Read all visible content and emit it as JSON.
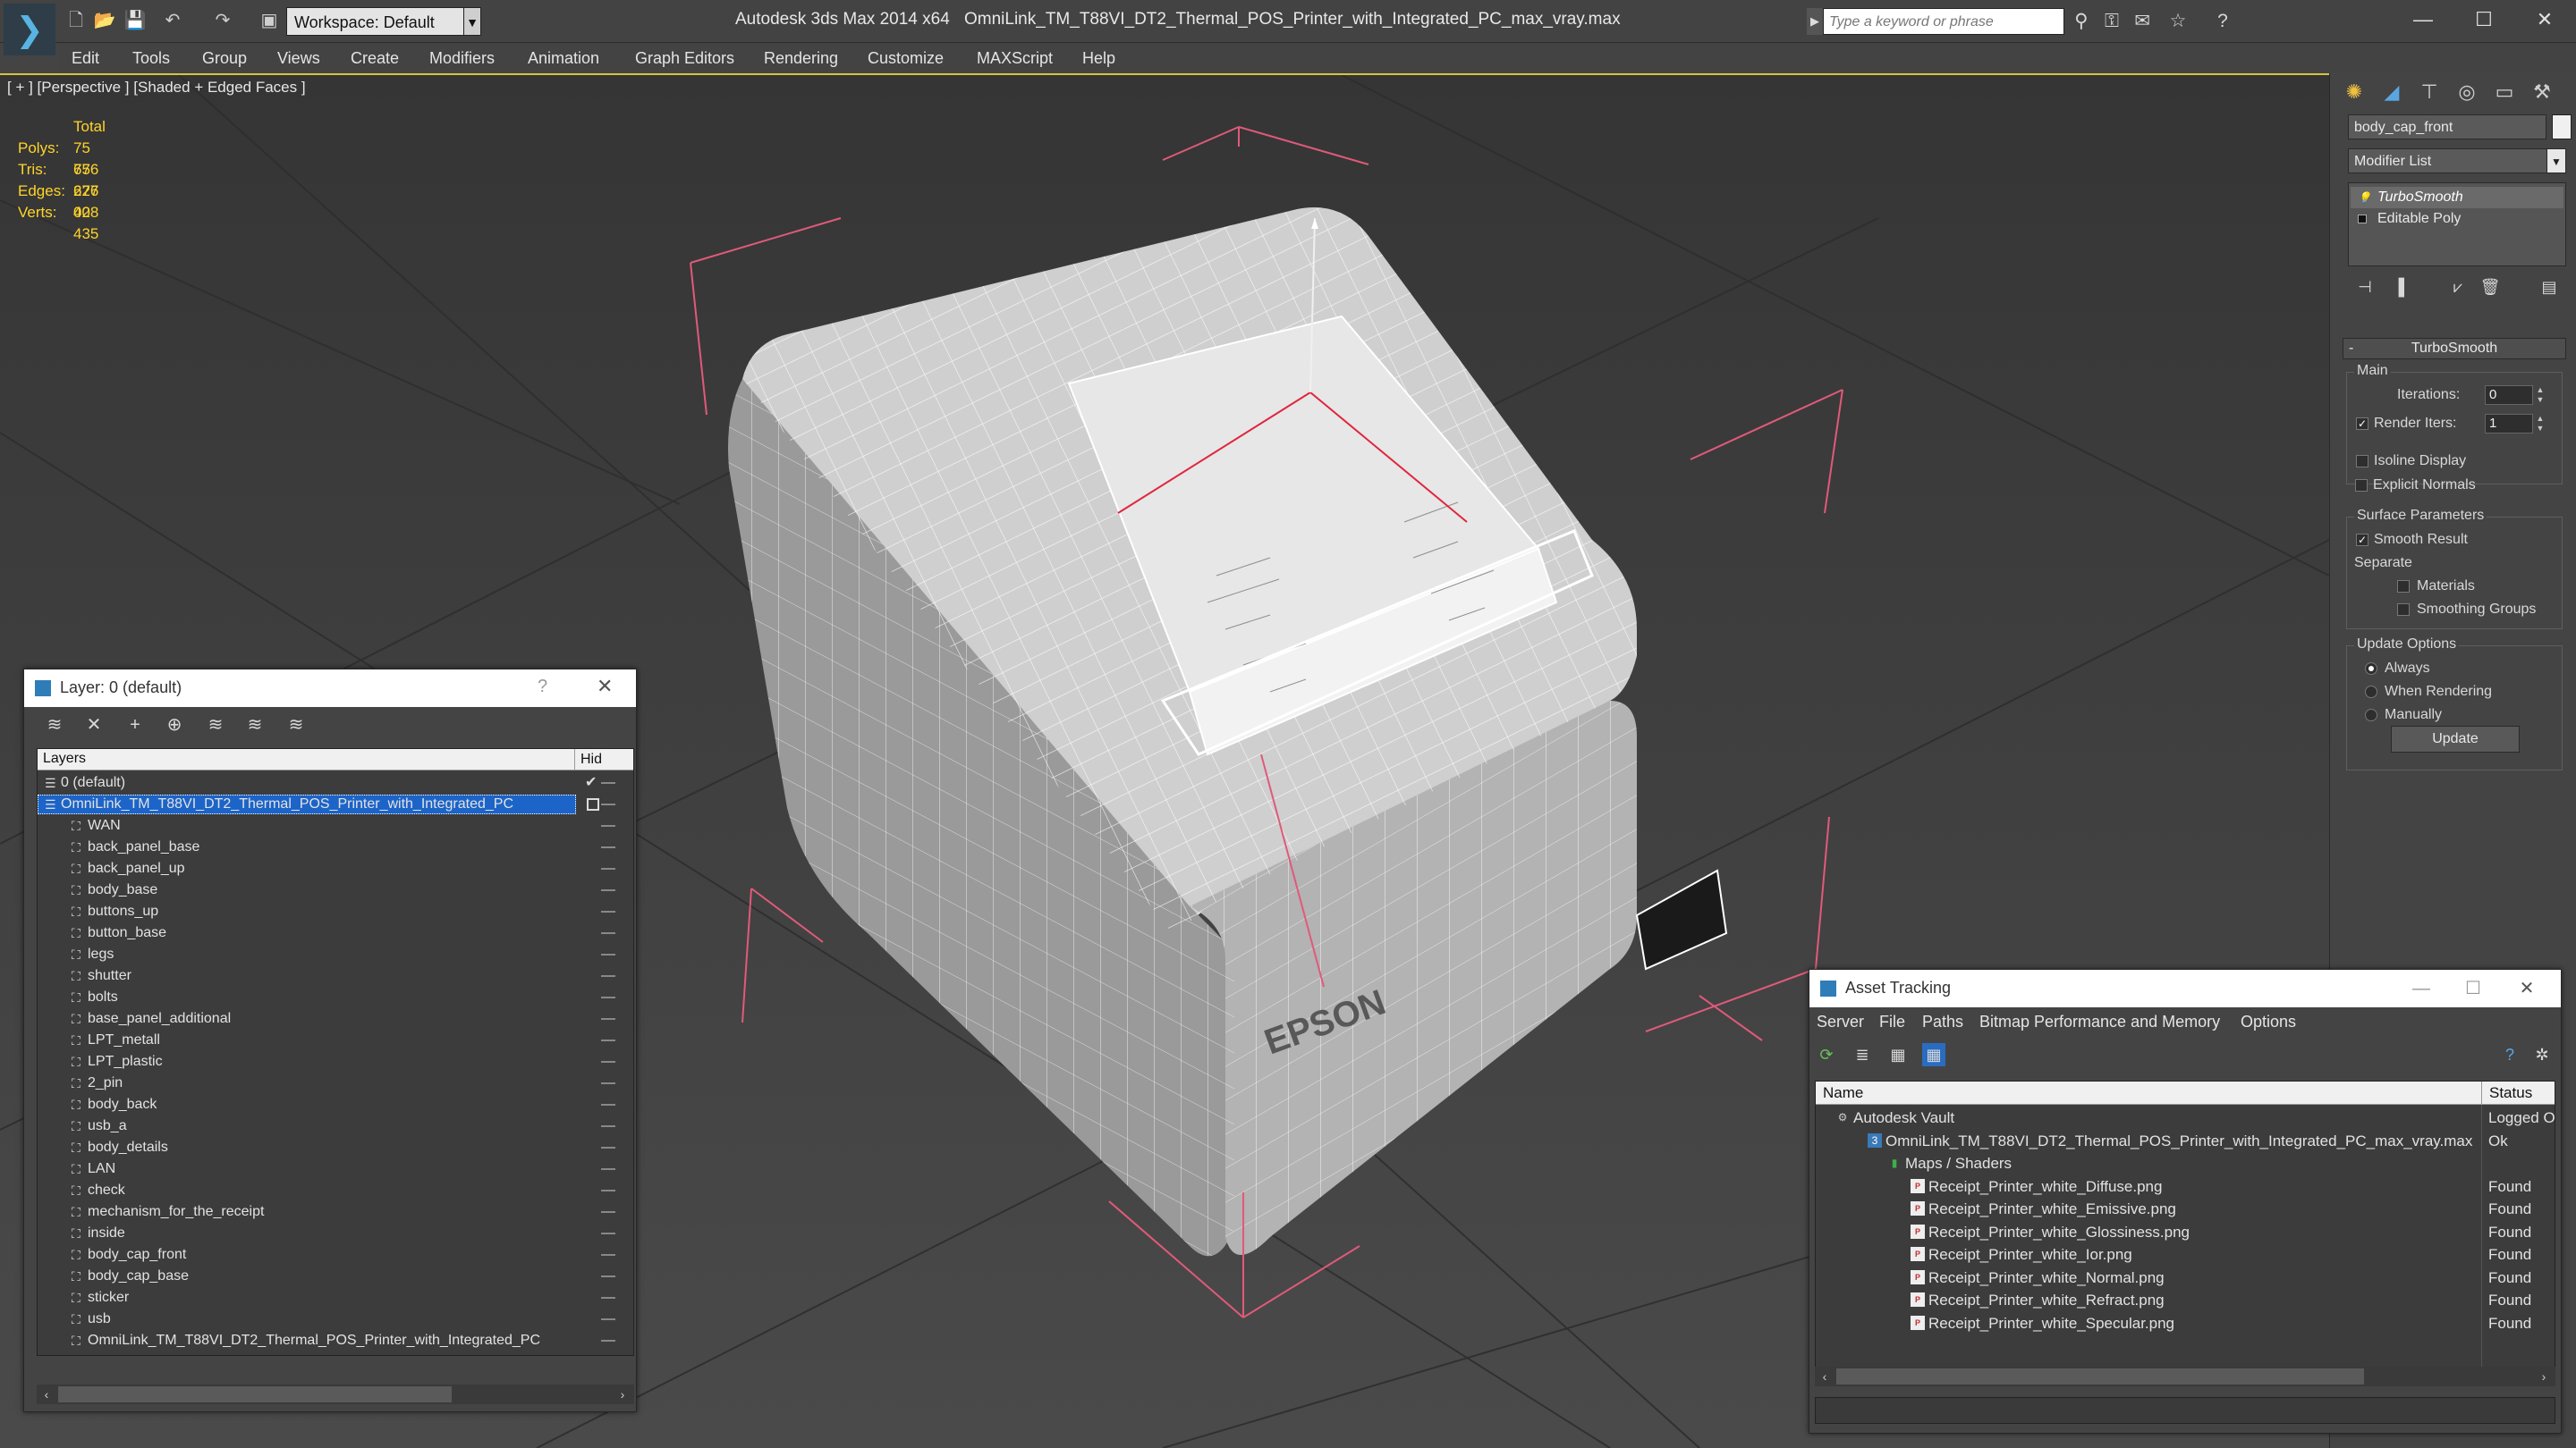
{
  "titlebar": {
    "workspace": "Workspace: Default",
    "app_name": "Autodesk 3ds Max  2014 x64",
    "document": "OmniLink_TM_T88VI_DT2_Thermal_POS_Printer_with_Integrated_PC_max_vray.max",
    "search_placeholder": "Type a keyword or phrase"
  },
  "menu": [
    "Edit",
    "Tools",
    "Group",
    "Views",
    "Create",
    "Modifiers",
    "Animation",
    "Graph Editors",
    "Rendering",
    "Customize",
    "MAXScript",
    "Help"
  ],
  "viewport": {
    "label": "[ + ] [Perspective ] [Shaded + Edged Faces ]",
    "stats": {
      "header": "Total",
      "rows": [
        {
          "k": "Polys:",
          "v": "75 676"
        },
        {
          "k": "Tris:",
          "v": "75 676"
        },
        {
          "k": "Edges:",
          "v": "227 028"
        },
        {
          "k": "Verts:",
          "v": "40 435"
        }
      ]
    },
    "brand_text": "EPSON"
  },
  "command_panel": {
    "object_name": "body_cap_front",
    "modifier_list": "Modifier List",
    "stack": [
      "TurboSmooth",
      "Editable Poly"
    ],
    "rollout_title": "TurboSmooth",
    "main_label": "Main",
    "iterations_label": "Iterations:",
    "iterations_value": "0",
    "render_iters_label": "Render Iters:",
    "render_iters_value": "1",
    "isoline_label": "Isoline Display",
    "explicit_label": "Explicit Normals",
    "surface_label": "Surface Parameters",
    "smooth_label": "Smooth Result",
    "separate_label": "Separate",
    "materials_label": "Materials",
    "smoothing_label": "Smoothing Groups",
    "update_options_label": "Update Options",
    "always_label": "Always",
    "when_rendering_label": "When Rendering",
    "manually_label": "Manually",
    "update_button": "Update"
  },
  "layer_window": {
    "title": "Layer: 0 (default)",
    "help": "?",
    "header_name": "Layers",
    "header_hide": "Hid",
    "layers": [
      "0 (default)",
      "OmniLink_TM_T88VI_DT2_Thermal_POS_Printer_with_Integrated_PC",
      "WAN",
      "back_panel_base",
      "back_panel_up",
      "body_base",
      "buttons_up",
      "button_base",
      "legs",
      "shutter",
      "bolts",
      "base_panel_additional",
      "LPT_metall",
      "LPT_plastic",
      "2_pin",
      "body_back",
      "usb_a",
      "body_details",
      "LAN",
      "check",
      "mechanism_for_the_receipt",
      "inside",
      "body_cap_front",
      "body_cap_base",
      "sticker",
      "usb",
      "OmniLink_TM_T88VI_DT2_Thermal_POS_Printer_with_Integrated_PC"
    ]
  },
  "asset_window": {
    "title": "Asset Tracking",
    "menu": [
      "Server",
      "File",
      "Paths",
      "Bitmap Performance and Memory",
      "Options"
    ],
    "col_name": "Name",
    "col_status": "Status",
    "rows": [
      {
        "name": "Autodesk Vault",
        "status": "Logged O"
      },
      {
        "name": "OmniLink_TM_T88VI_DT2_Thermal_POS_Printer_with_Integrated_PC_max_vray.max",
        "status": "Ok"
      },
      {
        "name": "Maps / Shaders",
        "status": ""
      },
      {
        "name": "Receipt_Printer_white_Diffuse.png",
        "status": "Found"
      },
      {
        "name": "Receipt_Printer_white_Emissive.png",
        "status": "Found"
      },
      {
        "name": "Receipt_Printer_white_Glossiness.png",
        "status": "Found"
      },
      {
        "name": "Receipt_Printer_white_Ior.png",
        "status": "Found"
      },
      {
        "name": "Receipt_Printer_white_Normal.png",
        "status": "Found"
      },
      {
        "name": "Receipt_Printer_white_Refract.png",
        "status": "Found"
      },
      {
        "name": "Receipt_Printer_white_Specular.png",
        "status": "Found"
      }
    ]
  },
  "colors": {
    "viewport_bg": "#3e3e3e",
    "active_border": "#d7c43f",
    "stats_text": "#ffd42a",
    "selection": "#1c64c8",
    "bbox_lines": "#e05a7a",
    "wire": "#ffffff"
  }
}
